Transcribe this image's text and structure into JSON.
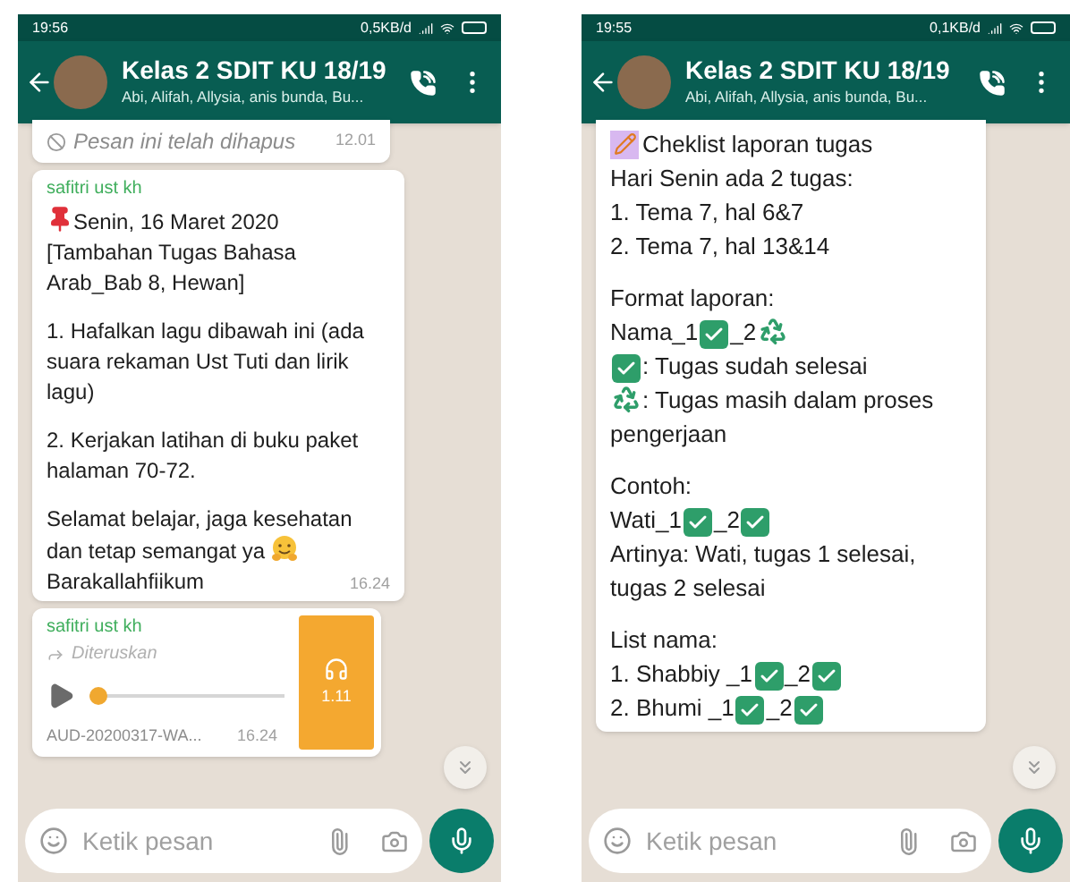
{
  "phones": [
    {
      "status_bar": {
        "time": "19:56",
        "speed": "0,5KB/d"
      },
      "header": {
        "title": "Kelas 2 SDIT KU 18/19",
        "subtitle": "Abi, Alifah, Allysia, anis bunda, Bu..."
      },
      "messages": [
        {
          "kind": "deleted",
          "text": "Pesan ini telah dihapus",
          "time": "12.01"
        },
        {
          "kind": "text",
          "sender": "safitri ust kh",
          "time": "16.24",
          "paragraphs": [
            [
              [
                {
                  "kind": "pin"
                },
                {
                  "kind": "text",
                  "text": "Senin, 16 Maret 2020"
                }
              ],
              [
                {
                  "kind": "text",
                  "text": "[Tambahan Tugas Bahasa Arab_Bab 8, Hewan]"
                }
              ]
            ],
            [
              [
                {
                  "kind": "text",
                  "text": "1. Hafalkan lagu dibawah ini (ada suara rekaman Ust Tuti dan lirik lagu)"
                }
              ]
            ],
            [
              [
                {
                  "kind": "text",
                  "text": "2. Kerjakan latihan di buku paket halaman 70-72."
                }
              ]
            ],
            [
              [
                {
                  "kind": "text",
                  "text": "Selamat belajar, jaga kesehatan"
                }
              ],
              [
                {
                  "kind": "text",
                  "text": "dan tetap semangat ya"
                },
                {
                  "kind": "hug"
                }
              ],
              [
                {
                  "kind": "text",
                  "text": "Barakallahfiikum"
                }
              ]
            ]
          ]
        },
        {
          "kind": "audio",
          "sender": "safitri ust kh",
          "forwarded_label": "Diteruskan",
          "file_name": "AUD-20200317-WA...",
          "time": "16.24",
          "duration": "1.11",
          "level": 0.05
        }
      ],
      "input": {
        "placeholder": "Ketik pesan"
      }
    },
    {
      "status_bar": {
        "time": "19:55",
        "speed": "0,1KB/d"
      },
      "header": {
        "title": "Kelas 2 SDIT KU 18/19",
        "subtitle": "Abi, Alifah, Allysia, anis bunda, Bu..."
      },
      "messages": [
        {
          "kind": "text",
          "paragraphs": [
            [
              [
                {
                  "kind": "pencil"
                },
                {
                  "kind": "text",
                  "text": "Cheklist laporan tugas"
                }
              ],
              [
                {
                  "kind": "text",
                  "text": "Hari Senin ada 2 tugas:"
                }
              ],
              [
                {
                  "kind": "text",
                  "text": "1. Tema 7, hal 6&7"
                }
              ],
              [
                {
                  "kind": "text",
                  "text": "2. Tema 7, hal 13&14"
                }
              ]
            ],
            [
              [
                {
                  "kind": "text",
                  "text": "Format laporan:"
                }
              ],
              [
                {
                  "kind": "text",
                  "text": "Nama_1"
                },
                {
                  "kind": "check"
                },
                {
                  "kind": "text",
                  "text": "_2"
                },
                {
                  "kind": "recycle"
                }
              ],
              [
                {
                  "kind": "check"
                },
                {
                  "kind": "text",
                  "text": ": Tugas sudah selesai"
                }
              ],
              [
                {
                  "kind": "recycle"
                },
                {
                  "kind": "text",
                  "text": ": Tugas masih dalam proses"
                }
              ],
              [
                {
                  "kind": "text",
                  "text": "pengerjaan"
                }
              ]
            ],
            [
              [
                {
                  "kind": "text",
                  "text": "Contoh:"
                }
              ],
              [
                {
                  "kind": "text",
                  "text": "Wati_1"
                },
                {
                  "kind": "check"
                },
                {
                  "kind": "text",
                  "text": "_2"
                },
                {
                  "kind": "check"
                }
              ],
              [
                {
                  "kind": "text",
                  "text": "Artinya: Wati, tugas 1 selesai, tugas 2 selesai"
                }
              ]
            ],
            [
              [
                {
                  "kind": "text",
                  "text": "List nama:"
                }
              ],
              [
                {
                  "kind": "text",
                  "text": "1. Shabbiy _1"
                },
                {
                  "kind": "check"
                },
                {
                  "kind": "text",
                  "text": "_2"
                },
                {
                  "kind": "check"
                }
              ],
              [
                {
                  "kind": "text",
                  "text": "2. Bhumi _1"
                },
                {
                  "kind": "check"
                },
                {
                  "kind": "text",
                  "text": "_2"
                },
                {
                  "kind": "check"
                }
              ]
            ]
          ]
        }
      ],
      "input": {
        "placeholder": "Ketik pesan"
      }
    }
  ]
}
